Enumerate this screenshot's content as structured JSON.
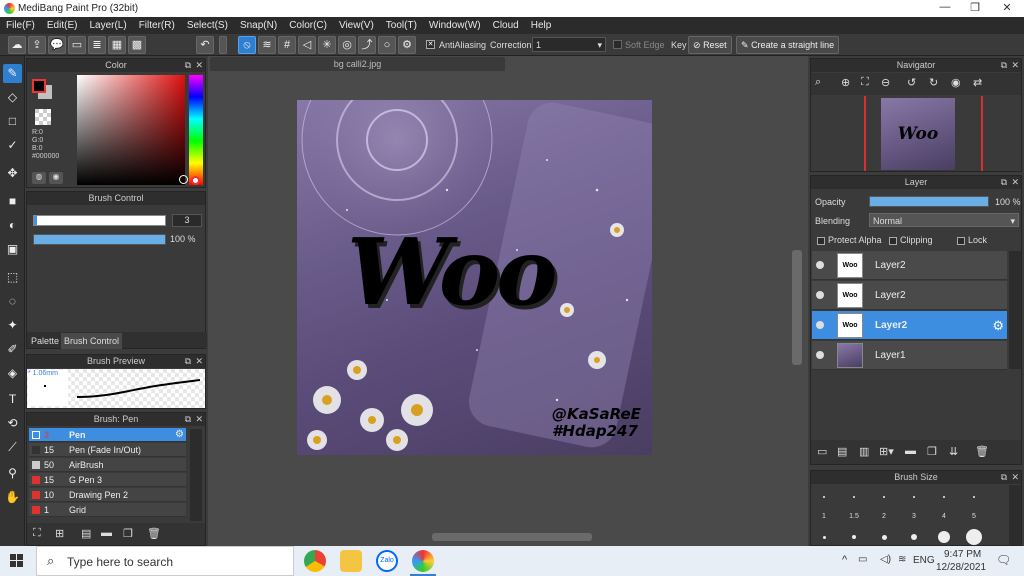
{
  "window": {
    "title": "MediBang Paint Pro (32bit)",
    "minimize": "—",
    "maximize": "❐",
    "close": "✕"
  },
  "menu": [
    "File(F)",
    "Edit(E)",
    "Layer(L)",
    "Filter(R)",
    "Select(S)",
    "Snap(N)",
    "Color(C)",
    "View(V)",
    "Tool(T)",
    "Window(W)",
    "Cloud",
    "Help"
  ],
  "toolbar": {
    "antialiasing_label": "AntiAliasing",
    "correction_label": "Correction",
    "correction_value": "1",
    "soft_edge_label": "Soft Edge",
    "key_label": "Key",
    "reset_label": "Reset",
    "straight_line_label": "Create a straight line"
  },
  "color_panel": {
    "title": "Color",
    "r": "R:0",
    "g": "G:0",
    "b": "B:0",
    "hex": "#000000",
    "fg_color": "#000000",
    "bg_color": "#c0c0c0"
  },
  "brush_control": {
    "title": "Brush Control",
    "size_value": "3",
    "opacity_value": "100 %",
    "opacity_fraction": 1.0,
    "size_fraction": 0.02
  },
  "panel_tabs": [
    "Palette",
    "Brush Control"
  ],
  "brush_preview": {
    "title": "Brush Preview",
    "size_label": "1.06mm"
  },
  "brush_list": {
    "title": "Brush: Pen",
    "items": [
      {
        "size": "3",
        "name": "Pen",
        "color": "#3d8ee0",
        "selected": true
      },
      {
        "size": "15",
        "name": "Pen (Fade In/Out)",
        "color": "#333333",
        "selected": false
      },
      {
        "size": "50",
        "name": "AirBrush",
        "color": "#cccccc",
        "selected": false
      },
      {
        "size": "15",
        "name": "G Pen 3",
        "color": "#e03030",
        "selected": false
      },
      {
        "size": "10",
        "name": "Drawing Pen 2",
        "color": "#e03030",
        "selected": false
      },
      {
        "size": "1",
        "name": "Grid",
        "color": "#e03030",
        "selected": false
      }
    ]
  },
  "document": {
    "tab_name": "bg calli2.jpg",
    "main_text": "Woo",
    "credit_line1": "@KaSaReE",
    "credit_line2": "#Hdap247"
  },
  "navigator": {
    "title": "Navigator",
    "thumb_text": "Woo"
  },
  "layer_panel": {
    "title": "Layer",
    "opacity_label": "Opacity",
    "opacity_value": "100 %",
    "blending_label": "Blending",
    "blending_value": "Normal",
    "protect_alpha": "Protect Alpha",
    "clipping": "Clipping",
    "lock": "Lock",
    "layers": [
      {
        "name": "Layer2",
        "thumb": "Woo",
        "selected": false
      },
      {
        "name": "Layer2",
        "thumb": "Woo",
        "selected": false
      },
      {
        "name": "Layer2",
        "thumb": "Woo",
        "selected": true
      },
      {
        "name": "Layer1",
        "thumb": "",
        "selected": false
      }
    ]
  },
  "brush_size": {
    "title": "Brush Size",
    "labels": [
      "1",
      "1.5",
      "2",
      "3",
      "4",
      "5"
    ]
  },
  "taskbar": {
    "search_placeholder": "Type here to search",
    "zalo": "Zalo",
    "lang": "ENG",
    "time": "9:47 PM",
    "date": "12/28/2021"
  }
}
